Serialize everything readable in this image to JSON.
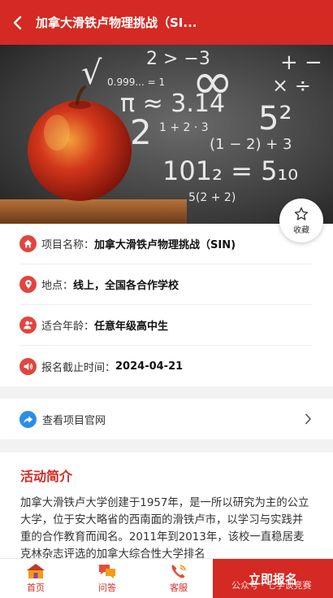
{
  "header": {
    "title": "加拿大滑铁卢物理挑战（SI..."
  },
  "hero": {
    "chalk_texts": [
      "√",
      "0.999... = 1",
      "2 > −3",
      "∞",
      "+ −",
      "× ÷",
      "π ≈ 3.14",
      "2",
      "1 + 2 · 3",
      "5²",
      "(1 − 2) + 3",
      "101₂ = 5₁₀",
      "5(2 + 2)"
    ]
  },
  "favorite": {
    "label": "收藏"
  },
  "info": {
    "rows": [
      {
        "icon": "home-icon",
        "label": "项目名称：",
        "value": "加拿大滑铁卢物理挑战（SIN)"
      },
      {
        "icon": "location-pin-icon",
        "label": "地点：",
        "value": "线上，全国各合作学校"
      },
      {
        "icon": "user-icon",
        "label": "适合年龄：",
        "value": "任意年级高中生"
      },
      {
        "icon": "speaker-icon",
        "label": "报名截止时间：",
        "value": "2024-04-21"
      }
    ]
  },
  "link": {
    "label": "查看项目官网"
  },
  "intro": {
    "heading": "活动简介",
    "text": "加拿大滑铁卢大学创建于1957年，是一所以研究为主的公立大学，位于安大略省的西南面的滑铁卢市，以学习与实践并重的合作教育而闻名。2011年到2013年，该校一直稳居麦克林杂志评选的加拿大综合性大学排名"
  },
  "bottom": {
    "tabs": [
      {
        "label": "首页",
        "icon": "home-house-icon"
      },
      {
        "label": "问答",
        "icon": "chat-bubbles-icon"
      },
      {
        "label": "客服",
        "icon": "phone-icon"
      }
    ],
    "signup_label": "立即报名",
    "watermark": "公众号 · 七学谈竞赛"
  },
  "colors": {
    "primary": "#d42a23",
    "link_icon": "#2a8ee6"
  }
}
